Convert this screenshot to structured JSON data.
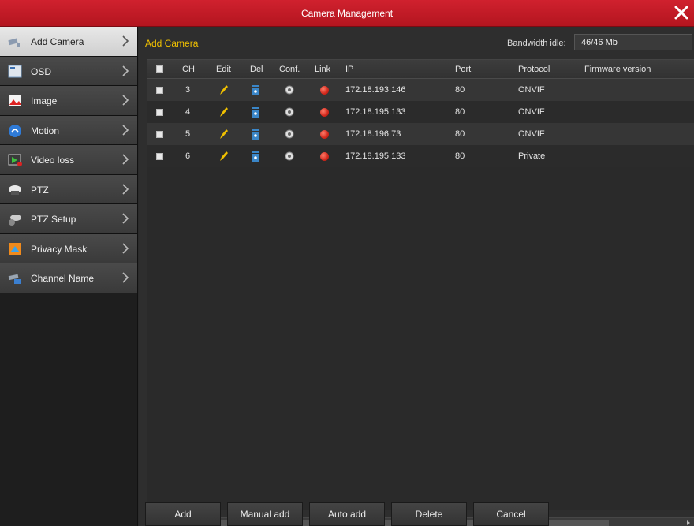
{
  "window": {
    "title": "Camera Management",
    "close_icon": "close-icon"
  },
  "sidebar": {
    "items": [
      {
        "label": "Add Camera",
        "icon": "camera-icon",
        "active": true
      },
      {
        "label": "OSD",
        "icon": "osd-icon",
        "active": false
      },
      {
        "label": "Image",
        "icon": "image-icon",
        "active": false
      },
      {
        "label": "Motion",
        "icon": "motion-icon",
        "active": false
      },
      {
        "label": "Video loss",
        "icon": "video-loss-icon",
        "active": false
      },
      {
        "label": "PTZ",
        "icon": "ptz-icon",
        "active": false
      },
      {
        "label": "PTZ Setup",
        "icon": "ptz-setup-icon",
        "active": false
      },
      {
        "label": "Privacy Mask",
        "icon": "privacy-mask-icon",
        "active": false
      },
      {
        "label": "Channel Name",
        "icon": "channel-name-icon",
        "active": false
      }
    ]
  },
  "main": {
    "section_title": "Add Camera",
    "bandwidth_label": "Bandwidth idle:",
    "bandwidth_value": "46/46 Mb",
    "table": {
      "headers": [
        "CH",
        "Edit",
        "Del",
        "Conf.",
        "Link",
        "IP",
        "Port",
        "Protocol",
        "Firmware version"
      ],
      "rows": [
        {
          "ch": "3",
          "ip": "172.18.193.146",
          "port": "80",
          "protocol": "ONVIF",
          "firmware": ""
        },
        {
          "ch": "4",
          "ip": "172.18.195.133",
          "port": "80",
          "protocol": "ONVIF",
          "firmware": ""
        },
        {
          "ch": "5",
          "ip": "172.18.196.73",
          "port": "80",
          "protocol": "ONVIF",
          "firmware": ""
        },
        {
          "ch": "6",
          "ip": "172.18.195.133",
          "port": "80",
          "protocol": "Private",
          "firmware": ""
        }
      ]
    },
    "buttons": [
      "Add",
      "Manual add",
      "Auto add",
      "Delete",
      "Cancel"
    ]
  },
  "colors": {
    "title_bar": "#c81b27",
    "section_title": "#f2c200",
    "link_status": "#d2281c",
    "edit_icon": "#f0c000",
    "delete_icon": "#3a86c8"
  }
}
